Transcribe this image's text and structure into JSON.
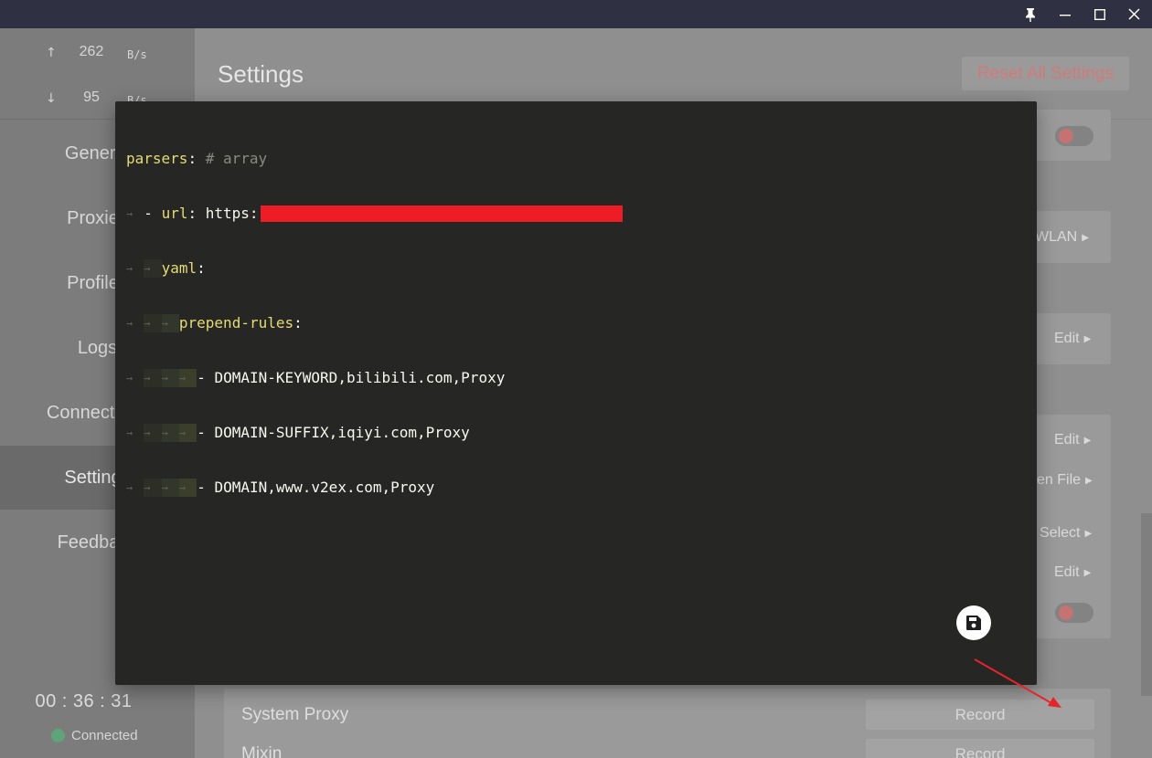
{
  "window": {
    "controls": [
      "pin-icon",
      "minimize-icon",
      "maximize-icon",
      "close-icon"
    ]
  },
  "sidebar": {
    "traffic": {
      "upload": {
        "arrow": "↑",
        "value": "262",
        "unit": "B/s"
      },
      "download": {
        "arrow": "↓",
        "value": "95",
        "unit": "B/s"
      }
    },
    "items": [
      {
        "label": "General"
      },
      {
        "label": "Proxies"
      },
      {
        "label": "Profiles"
      },
      {
        "label": "Logs"
      },
      {
        "label": "Connections"
      },
      {
        "label": "Settings",
        "active": true
      },
      {
        "label": "Feedback"
      }
    ],
    "timer": "00 : 36 : 31",
    "status": "Connected"
  },
  "main": {
    "title": "Settings",
    "reset_label": "Reset All Settings",
    "actions": {
      "wlan": "WLAN",
      "edit1": "Edit",
      "edit2": "Edit",
      "open_file": "en File",
      "select": "Select",
      "edit3": "Edit"
    },
    "rows": [
      {
        "label": "System Proxy",
        "button": "Record"
      },
      {
        "label": "Mixin",
        "button": "Record"
      }
    ]
  },
  "editor": {
    "lines": {
      "l1_key": "parsers",
      "l1_colon": ":",
      "l1_comment": "# array",
      "l2_dash": "- ",
      "l2_key": "url",
      "l2_colon": ":",
      "l2_value": " https:",
      "l3_key": "yaml",
      "l3_colon": ":",
      "l4_key": "prepend-rules",
      "l4_colon": ":",
      "l5": "- DOMAIN-KEYWORD,bilibili.com,Proxy",
      "l6": "- DOMAIN-SUFFIX,iqiyi.com,Proxy",
      "l7": "- DOMAIN,www.v2ex.com,Proxy"
    },
    "indent_glyph": "→",
    "save_icon": "floppy-disk-icon"
  },
  "colors": {
    "titlebar": "#2f3142",
    "editor_bg": "#262624",
    "yaml_key": "#e6db74",
    "redaction": "#ee1c25",
    "annotation_arrow": "#e8242b"
  }
}
